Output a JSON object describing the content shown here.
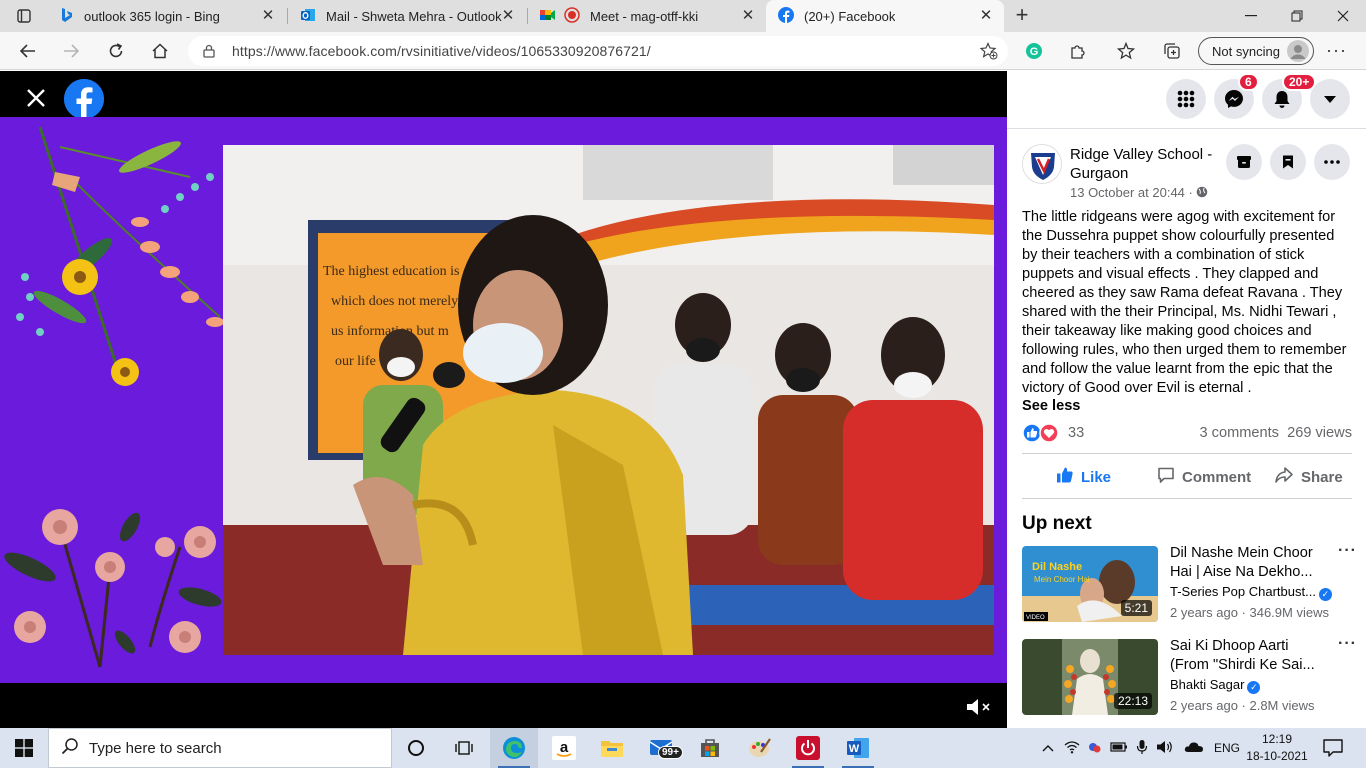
{
  "browser": {
    "tabs": [
      {
        "title": "outlook 365 login - Bing",
        "active": false
      },
      {
        "title": "Mail - Shweta Mehra - Outlook",
        "active": false
      },
      {
        "title": "Meet - mag-otff-kki",
        "active": false
      },
      {
        "title": "(20+) Facebook",
        "active": true
      }
    ],
    "url": "https://www.facebook.com/rvsinitiative/videos/1065330920876721/",
    "sync_label": "Not syncing"
  },
  "facebook": {
    "messenger_badge": "6",
    "notifications_badge": "20+",
    "post": {
      "page_name": "Ridge Valley School - Gurgaon",
      "time": "13 October at 20:44 ·",
      "text": "The little ridgeans were agog with excitement for the Dussehra puppet show colourfully presented by their teachers with a combination of stick puppets and visual effects . They clapped and cheered as they saw Rama defeat Ravana . They shared with the their Principal, Ms. Nidhi Tewari , their takeaway like making good choices and following rules, who then urged them to remember and follow the value learnt from the epic that the victory of Good over Evil is eternal .",
      "see_less": "See less",
      "reaction_count": "33",
      "comments": "3 comments",
      "views": "269 views",
      "like_label": "Like",
      "comment_label": "Comment",
      "share_label": "Share"
    },
    "up_next_title": "Up next",
    "up_next": [
      {
        "title": "Dil Nashe Mein Choor Hai | Aise Na Dekho...",
        "channel": "T-Series Pop Chartbust...",
        "meta": "2 years ago · 346.9M views",
        "duration": "5:21",
        "thumb_text": "Dil Nashe Mein Choor Hai",
        "thumb_tag": "VIDEO"
      },
      {
        "title": "Sai Ki Dhoop Aarti (From \"Shirdi Ke Sai...",
        "channel": "Bhakti Sagar",
        "meta": "2 years ago · 2.8M views",
        "duration": "22:13"
      }
    ],
    "video_poster_text": [
      "The highest education is",
      "which does not merely",
      "us information but m",
      "our life"
    ]
  },
  "taskbar": {
    "search_placeholder": "Type here to search",
    "store_badge": "99+",
    "language": "ENG",
    "time": "12:19",
    "date": "18-10-2021"
  },
  "colors": {
    "facebook_blue": "#1877f2",
    "video_background": "#6a1bdc",
    "badge_red": "#e41e3f"
  }
}
